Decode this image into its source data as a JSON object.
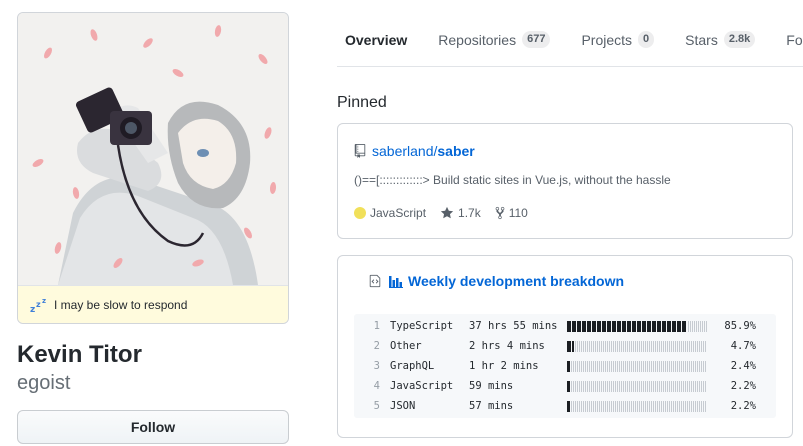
{
  "profile": {
    "status": "I may be slow to respond",
    "name": "Kevin Titor",
    "login": "egoist",
    "follow_label": "Follow"
  },
  "tabs": [
    {
      "label": "Overview",
      "counter": null,
      "selected": true
    },
    {
      "label": "Repositories",
      "counter": "677",
      "selected": false
    },
    {
      "label": "Projects",
      "counter": "0",
      "selected": false
    },
    {
      "label": "Stars",
      "counter": "2.8k",
      "selected": false
    },
    {
      "label": "Followers",
      "counter": null,
      "selected": false
    }
  ],
  "pinned": {
    "heading": "Pinned",
    "repo": {
      "owner": "saberland",
      "slash": "/",
      "name": "saber",
      "description": "()==[:::::::::::::> Build static sites in Vue.js, without the hassle",
      "language": "JavaScript",
      "language_color": "#f1e05a",
      "stars": "1.7k",
      "forks": "110"
    }
  },
  "gist": {
    "title": "Weekly development breakdown",
    "rows": [
      {
        "line": "1",
        "language": "TypeScript",
        "time": "37 hrs 55 mins",
        "percent": "85.9%",
        "fraction": 0.859
      },
      {
        "line": "2",
        "language": "Other",
        "time": "2 hrs 4 mins",
        "percent": "4.7%",
        "fraction": 0.047
      },
      {
        "line": "3",
        "language": "GraphQL",
        "time": "1 hr 2 mins",
        "percent": "2.4%",
        "fraction": 0.024
      },
      {
        "line": "4",
        "language": "JavaScript",
        "time": "59 mins",
        "percent": "2.2%",
        "fraction": 0.022
      },
      {
        "line": "5",
        "language": "JSON",
        "time": "57 mins",
        "percent": "2.2%",
        "fraction": 0.022
      }
    ]
  },
  "icons": {
    "status": "zzz-icon",
    "repo": "book-icon",
    "star": "star-icon",
    "fork": "fork-icon",
    "gist_file": "code-file-icon",
    "gist_chart": "bar-chart-icon"
  },
  "colors": {
    "accent": "#e36209",
    "link": "#0366d6",
    "status_bg": "#fffbdd"
  }
}
